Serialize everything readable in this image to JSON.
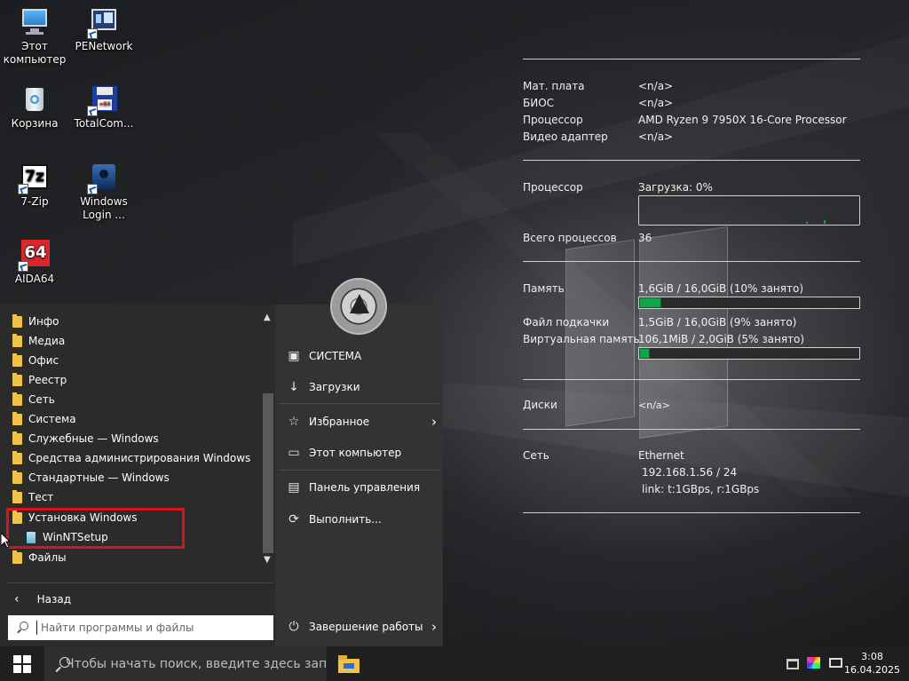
{
  "desktop": {
    "icons": [
      {
        "label_line1": "Этот",
        "label_line2": "компьютер",
        "icon": "this-pc-icon"
      },
      {
        "label_line1": "PENetwork",
        "label_line2": "",
        "icon": "penetwork-icon"
      },
      {
        "label_line1": "Корзина",
        "label_line2": "",
        "icon": "recycle-bin-icon"
      },
      {
        "label_line1": "TotalCom...",
        "label_line2": "",
        "icon": "total-commander-icon"
      },
      {
        "label_line1": "7-Zip",
        "label_line2": "",
        "icon": "7zip-icon"
      },
      {
        "label_line1": "Windows",
        "label_line2": "Login ...",
        "icon": "windows-login-icon"
      },
      {
        "label_line1": "AIDA64",
        "label_line2": "",
        "icon": "aida64-icon"
      }
    ]
  },
  "sysinfo": {
    "hw_rows": [
      {
        "label": "Мат. плата",
        "value": "<n/a>"
      },
      {
        "label": "БИОС",
        "value": "<n/a>"
      },
      {
        "label": "Процессор",
        "value": "AMD Ryzen 9 7950X 16-Core Processor"
      },
      {
        "label": "Видео адаптер",
        "value": "<n/a>"
      }
    ],
    "cpu_label": "Процессор",
    "cpu_load": "Загрузка:  0%",
    "proc_label": "Всего процессов",
    "proc_value": "36",
    "mem_label": "Память",
    "mem_value": "1,6GiB / 16,0GiB (10% занято)",
    "mem_fraction": 0.1,
    "pagefile_label": "Файл подкачки",
    "pagefile_value": "1,5GiB / 16,0GiB (9% занято)",
    "virt_label": "Виртуальная память",
    "virt_value": "106,1MiB / 2,0GiB (5% занято)",
    "virt_fraction": 0.05,
    "disks_label": "Диски",
    "disks_value": "<n/a>",
    "net_label": "Сеть",
    "net_adapter": "Ethernet",
    "net_ip": "192.168.1.56 / 24",
    "net_link": "link: t:1GBps, r:1GBps"
  },
  "start_menu": {
    "folders": [
      "Инфо",
      "Медиа",
      "Офис",
      "Реестр",
      "Сеть",
      "Система",
      "Служебные — Windows",
      "Средства администрирования Windows",
      "Стандартные — Windows",
      "Тест",
      "Установка Windows"
    ],
    "subitem": "WinNTSetup",
    "last_folder": "Файлы",
    "back_label": "Назад",
    "search_placeholder": "Найти программы и файлы",
    "right_items": {
      "system": "СИСТЕМА",
      "downloads": "Загрузки",
      "favorites": "Избранное",
      "this_pc": "Этот компьютер",
      "control_panel": "Панель управления",
      "run": "Выполнить...",
      "shutdown": "Завершение работы"
    }
  },
  "taskbar": {
    "search_text": "Чтобы начать поиск, введите здесь запр",
    "time": "3:08",
    "date": "16.04.2025"
  },
  "colors": {
    "accent_green": "#15a34a",
    "highlight_red": "#d7141c",
    "folder": "#f0c24b"
  }
}
